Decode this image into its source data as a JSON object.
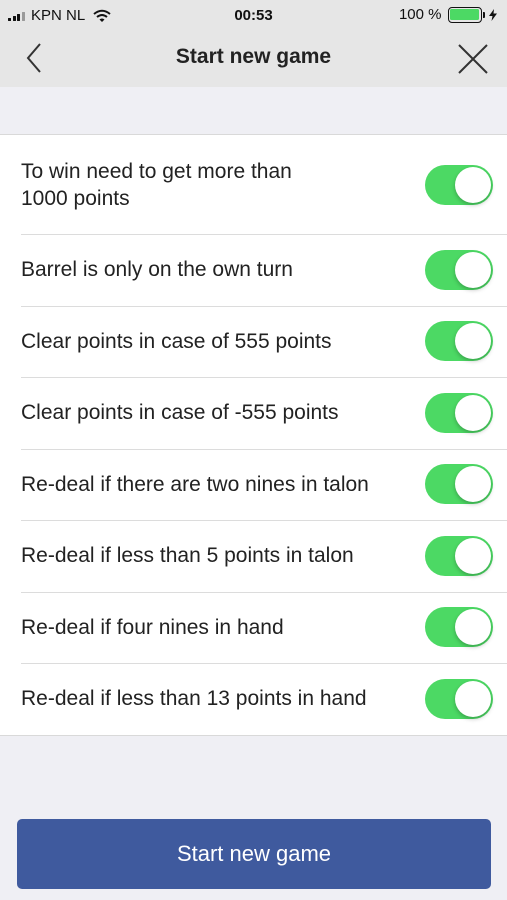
{
  "status_bar": {
    "carrier": "KPN NL",
    "time": "00:53",
    "battery": "100 %",
    "battery_level": 1.0,
    "icons": [
      "signal-icon",
      "wifi-icon",
      "battery-icon",
      "charging-bolt-icon"
    ]
  },
  "nav": {
    "title": "Start new game",
    "back_icon": "chevron-left-icon",
    "close_icon": "close-icon"
  },
  "settings": [
    {
      "label": "To win need to get more than\n1000 points",
      "enabled": true
    },
    {
      "label": "Barrel is only on the own turn",
      "enabled": true
    },
    {
      "label": "Clear points in case of 555 points",
      "enabled": true
    },
    {
      "label": "Clear points in case of -555 points",
      "enabled": true
    },
    {
      "label": "Re-deal if there are two nines in talon",
      "enabled": true
    },
    {
      "label": "Re-deal if less than 5 points in talon",
      "enabled": true
    },
    {
      "label": "Re-deal if four nines in hand",
      "enabled": true
    },
    {
      "label": "Re-deal if less than 13 points in hand",
      "enabled": true
    }
  ],
  "colors": {
    "toggle_on": "#4cd964",
    "primary_button": "#3f5a9e",
    "background": "#efeff4",
    "bar": "#e6e6e6"
  },
  "actions": {
    "start_label": "Start new game"
  }
}
